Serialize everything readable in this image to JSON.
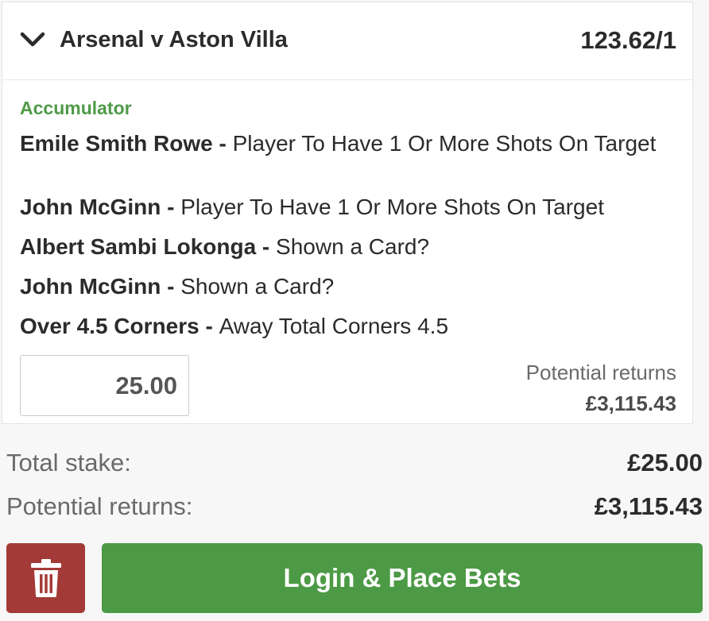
{
  "bet": {
    "event_title": "Arsenal v Aston Villa",
    "odds": "123.62/1",
    "bet_type": "Accumulator",
    "selections": [
      {
        "player": "Emile Smith Rowe",
        "separator": " - ",
        "market": "Player To Have 1 Or More Shots On Target"
      },
      {
        "player": "John McGinn",
        "separator": " - ",
        "market": "Player To Have 1 Or More Shots On Target"
      },
      {
        "player": "Albert Sambi Lokonga",
        "separator": " - ",
        "market": "Shown a Card?"
      },
      {
        "player": "John McGinn",
        "separator": " - ",
        "market": "Shown a Card?"
      },
      {
        "player": "Over 4.5 Corners",
        "separator": " - ",
        "market": "Away Total Corners 4.5"
      }
    ],
    "stake_value": "25.00",
    "potential_returns_label": "Potential returns",
    "potential_returns_value": "£3,115.43"
  },
  "summary": {
    "total_stake_label": "Total stake:",
    "total_stake_value": "£25.00",
    "potential_returns_label": "Potential returns:",
    "potential_returns_value": "£3,115.43"
  },
  "actions": {
    "delete_icon": "trash-icon",
    "place_bets_label": "Login & Place Bets"
  },
  "colors": {
    "accent_green": "#4c9a45",
    "bet_type_green": "#4f9b48",
    "delete_red": "#a43a37"
  }
}
